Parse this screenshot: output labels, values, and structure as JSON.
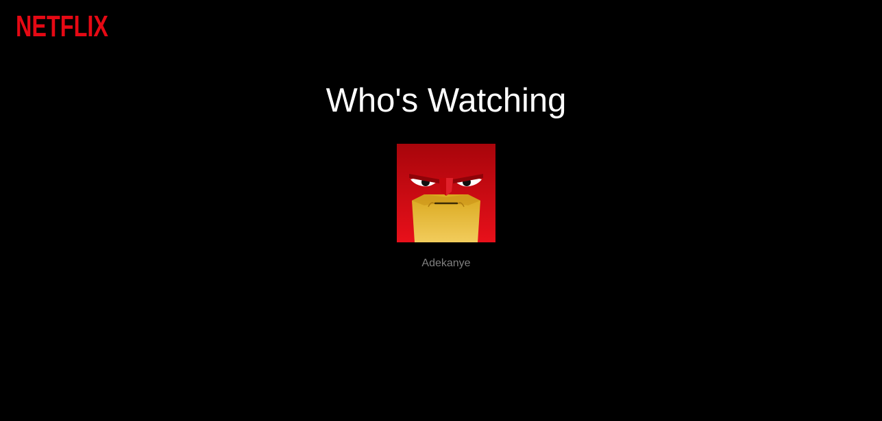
{
  "header": {
    "logo_text": "NETFLIX",
    "logo_color": "#e50914"
  },
  "main": {
    "title": "Who's Watching",
    "profiles": [
      {
        "name": "Adekanye",
        "avatar_icon": "red-angry-face-avatar"
      }
    ]
  },
  "colors": {
    "background": "#000000",
    "title_text": "#ffffff",
    "profile_name_text": "#808080",
    "avatar_red": "#e50914",
    "avatar_yellow": "#f0c030"
  }
}
